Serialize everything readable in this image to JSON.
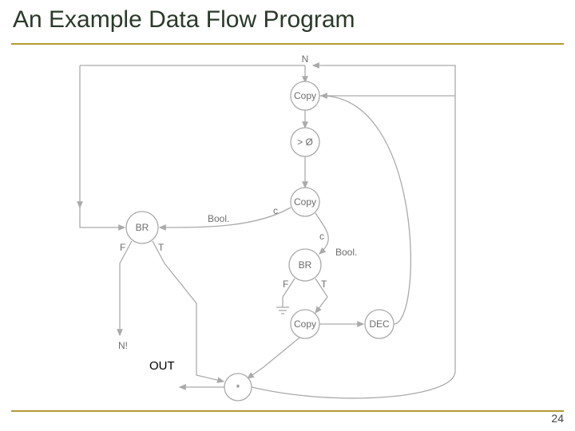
{
  "title": "An Example Data Flow Program",
  "page_number": "24",
  "diagram": {
    "input_label": "N",
    "nodes": {
      "copy1": "Copy",
      "gt0": "> Ø",
      "copy2": "Copy",
      "br1": "BR",
      "br2": "BR",
      "bool1": "Bool.",
      "bool2": "Bool.",
      "T": "T",
      "F": "F",
      "copy3": "Copy",
      "dec": "DEC",
      "mul": "*",
      "ni": "N!"
    },
    "out_label": "OUT"
  }
}
